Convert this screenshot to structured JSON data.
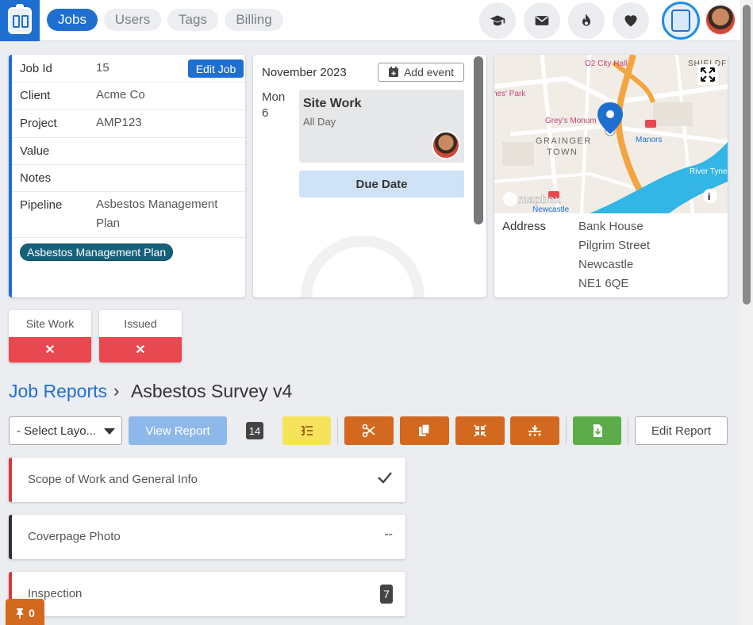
{
  "nav": {
    "tabs": [
      {
        "label": "Jobs",
        "active": true
      },
      {
        "label": "Users",
        "active": false
      },
      {
        "label": "Tags",
        "active": false
      },
      {
        "label": "Billing",
        "active": false
      }
    ],
    "icons": [
      "graduation-cap-icon",
      "envelope-icon",
      "fire-icon",
      "heart-icon"
    ]
  },
  "job": {
    "fields": [
      {
        "key": "Job Id",
        "value": "15"
      },
      {
        "key": "Client",
        "value": "Acme Co"
      },
      {
        "key": "Project",
        "value": "AMP123"
      },
      {
        "key": "Value",
        "value": ""
      },
      {
        "key": "Notes",
        "value": ""
      },
      {
        "key": "Pipeline",
        "value": "Asbestos Management Plan"
      }
    ],
    "edit_label": "Edit Job",
    "pipeline_pill": "Asbestos Management Plan"
  },
  "calendar": {
    "month": "November 2023",
    "add_event_label": "Add event",
    "day_name": "Mon",
    "day_num": "6",
    "event": {
      "title": "Site Work",
      "subtitle": "All Day"
    },
    "due_label": "Due Date"
  },
  "map": {
    "labels": {
      "o2": "O2 City Hall",
      "shieldfield": "SHIELDFIEL",
      "park": "nes' Park",
      "greys": "Grey's Monum",
      "grainger1": "GRAINGER",
      "grainger2": "TOWN",
      "manors": "Manors",
      "river": "River Tyne",
      "newcastle": "Newcastle",
      "mapbox": "mapbox"
    },
    "address_label": "Address",
    "address_lines": [
      "Bank House",
      "Pilgrim Street",
      "Newcastle",
      "NE1 6QE"
    ]
  },
  "statuses": [
    {
      "label": "Site Work",
      "mark": "✕"
    },
    {
      "label": "Issued",
      "mark": "✕"
    }
  ],
  "breadcrumb": {
    "parent": "Job Reports",
    "separator": "›",
    "current": "Asbestos Survey v4"
  },
  "toolbar": {
    "layout_select": "- Select Layo...",
    "view_report_label": "View Report",
    "count": "14",
    "edit_report_label": "Edit Report",
    "colors": {
      "yellow": "#f5e35a",
      "orange": "#d2691e",
      "green": "#5cad4a"
    }
  },
  "sections": [
    {
      "name": "Scope of Work and General Info",
      "status": "✓",
      "accent": "#d9363e"
    },
    {
      "name": "Coverpage Photo",
      "status": "--",
      "accent": "#333333"
    },
    {
      "name": "Inspection",
      "status": "7",
      "accent": "#d9363e"
    }
  ],
  "pinned": {
    "count": "0"
  }
}
